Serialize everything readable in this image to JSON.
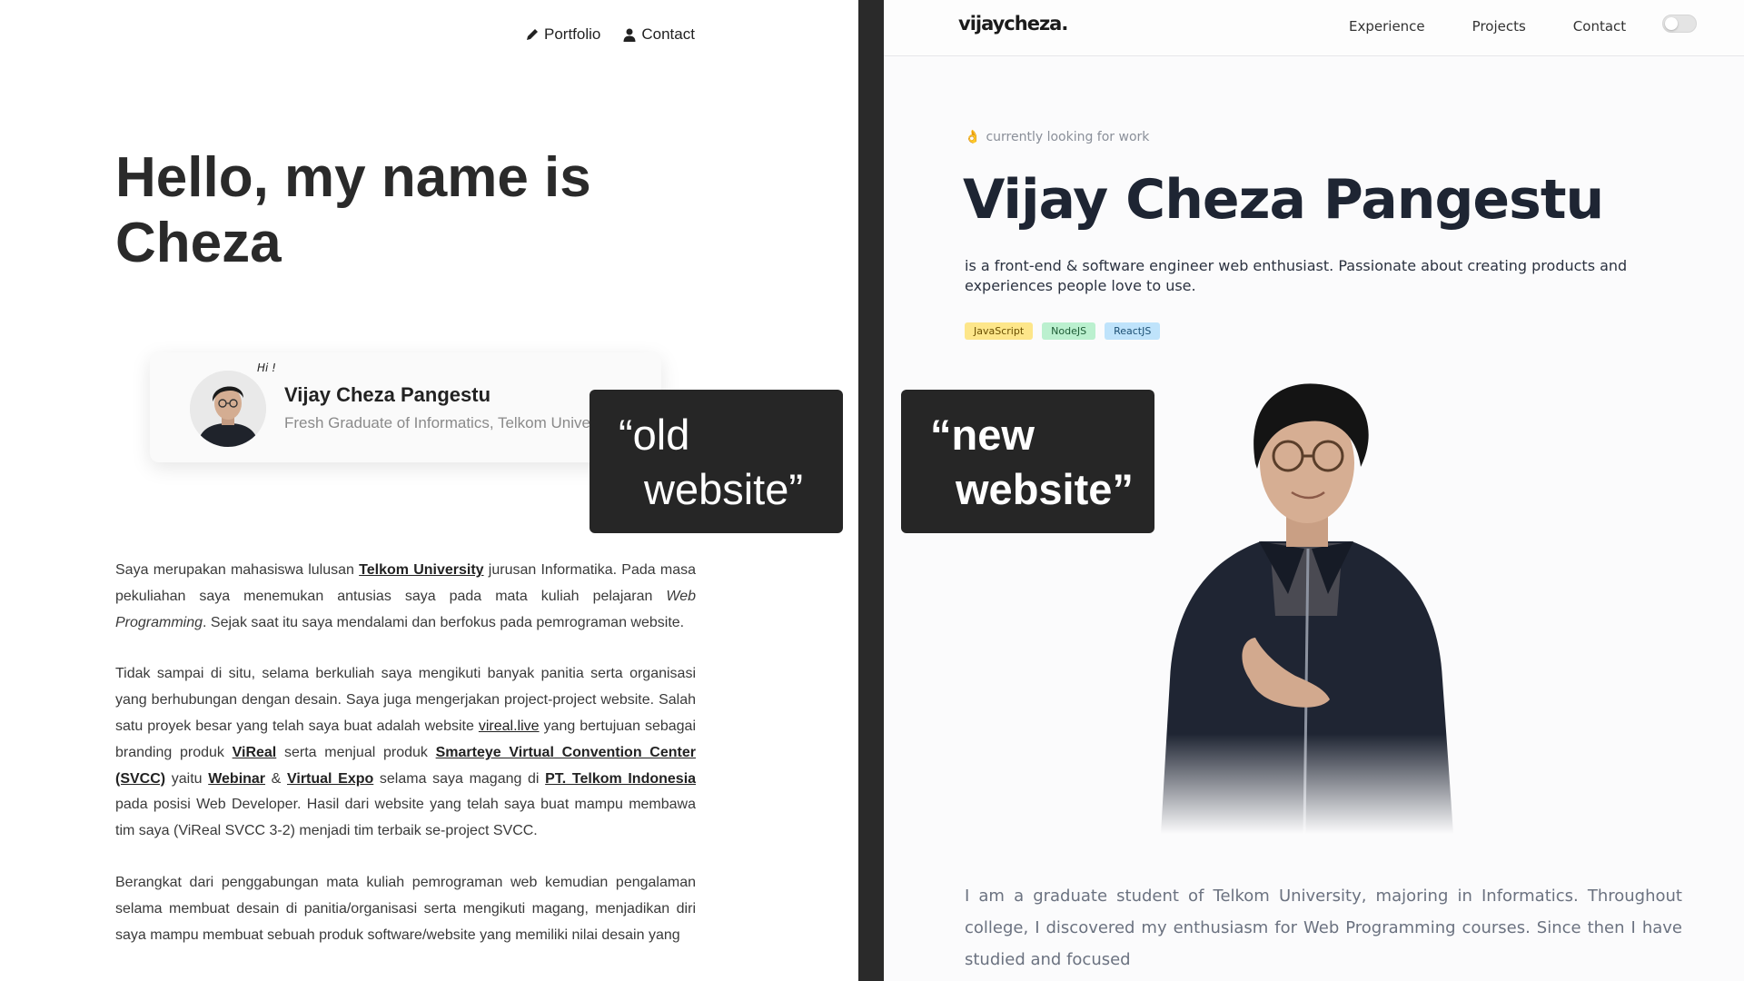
{
  "old_site": {
    "nav": {
      "portfolio": "Portfolio",
      "contact": "Contact"
    },
    "heading_line1": "Hello, my name is",
    "heading_line2": "Cheza",
    "card": {
      "hi": "Hi !",
      "name": "Vijay Cheza Pangestu",
      "subtitle": "Fresh Graduate of Informatics, Telkom University"
    },
    "p1": {
      "t1": "Saya merupakan mahasiswa lulusan ",
      "link1": "Telkom University",
      "t2": " jurusan Informatika. Pada masa pekuliahan saya menemukan antusias saya pada mata kuliah pelajaran ",
      "em": "Web Programming",
      "t3": ". Sejak saat itu saya mendalami dan berfokus pada pemrograman website."
    },
    "p2": {
      "t1": "Tidak sampai di situ, selama berkuliah saya mengikuti banyak panitia serta organisasi yang berhubungan dengan desain. Saya juga mengerjakan project-project website. Salah satu proyek besar yang telah saya buat adalah website ",
      "link1": "vireal.live",
      "t2": " yang bertujuan sebagai branding produk ",
      "link2": "ViReal",
      "t3": " serta menjual produk ",
      "link3": "Smarteye Virtual Convention Center (SVCC)",
      "t4": " yaitu ",
      "link4": "Webinar",
      "t5": " & ",
      "link5": "Virtual Expo",
      "t6": " selama saya magang di ",
      "link6": "PT. Telkom Indonesia",
      "t7": " pada posisi Web Developer. Hasil dari website yang telah saya buat mampu membawa tim saya (ViReal SVCC 3-2) menjadi tim terbaik se-project SVCC."
    },
    "p3": "Berangkat dari penggabungan mata kuliah pemrograman web kemudian pengalaman selama membuat desain di panitia/organisasi serta mengikuti magang, menjadikan diri saya mampu membuat sebuah produk software/website yang memiliki nilai desain yang"
  },
  "new_site": {
    "logo": "vijaycheza.",
    "nav": {
      "experience": "Experience",
      "projects": "Projects",
      "contact": "Contact"
    },
    "status_emoji": "👌",
    "status": "currently looking for work",
    "name": "Vijay Cheza Pangestu",
    "tagline": "is a front-end & software engineer web enthusiast. Passionate about creating products and experiences people love to use.",
    "tags": [
      "JavaScript",
      "NodeJS",
      "ReactJS"
    ],
    "bio": "I am a graduate student of Telkom University, majoring in Informatics. Throughout college, I discovered my enthusiasm for Web Programming courses. Since then I have studied and focused"
  },
  "labels": {
    "old_line1": "“old",
    "old_line2": "website”",
    "new_line1": "“new",
    "new_line2": "website”"
  },
  "colors": {
    "divider": "#2a2a2a",
    "label_bg": "#262626",
    "heading_dark": "#1e2533",
    "tag_js": "#fde68a",
    "tag_node": "#bbf0cf",
    "tag_react": "#bfe3fb"
  },
  "icons": {
    "portfolio_icon": "pencil-icon",
    "contact_icon": "user-icon",
    "theme_toggle": "toggle-switch"
  }
}
